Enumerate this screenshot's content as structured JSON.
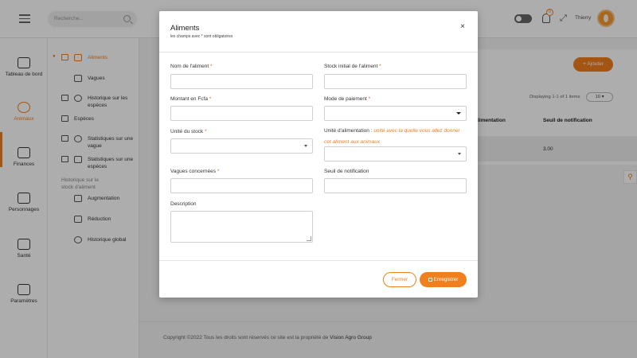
{
  "topbar": {
    "search_placeholder": "Recherche...",
    "notification_count": "0",
    "username": "Thierry"
  },
  "leftnav": {
    "items": [
      {
        "label": "Tableau de bord",
        "icon": "gauge-icon"
      },
      {
        "label": "Animaux",
        "icon": "paw-icon",
        "active": true
      },
      {
        "label": "Finances",
        "icon": "coins-icon"
      },
      {
        "label": "Personnages",
        "icon": "people-icon"
      },
      {
        "label": "Santé",
        "icon": "ambulance-icon"
      },
      {
        "label": "Paramètres",
        "icon": "sliders-icon"
      }
    ]
  },
  "subnav": {
    "items": [
      {
        "label": "Aliments",
        "active": true
      },
      {
        "label": "Vagues"
      },
      {
        "label": "Historique sur les espèces"
      },
      {
        "label": "Espèces"
      },
      {
        "label": "Statistiques sur une vague"
      },
      {
        "label": "Statistiques sur une espèces"
      },
      {
        "label": "Historique sur le stock d'aliment"
      },
      {
        "label": "Augmentation"
      },
      {
        "label": "Réduction"
      },
      {
        "label": "Historique global"
      }
    ]
  },
  "main": {
    "add_button": "+ Ajouter",
    "displaying": "Displaying 1-1 of 1 items",
    "page_size": "10 ▾",
    "table_headers": [
      "d'alimentation",
      "Seuil de notification"
    ],
    "row_values": [
      "3.00"
    ],
    "footer_text": "Copyright ©2022 Tous les droits sont réservés ce site est la propriété de ",
    "footer_brand": "Vision Agro Group"
  },
  "modal": {
    "title": "Aliments",
    "subtitle": "les champs avec * sont obligatoires",
    "close_symbol": "×",
    "fields": {
      "nom": {
        "label": "Nom de l'aliment",
        "required": "*",
        "value": ""
      },
      "stock_initial": {
        "label": "Stock initial de l'aliment",
        "required": "*",
        "value": ""
      },
      "montant": {
        "label": "Montant en Fcfa",
        "required": "*",
        "value": ""
      },
      "mode_paiement": {
        "label": "Mode de paiement",
        "required": "*",
        "value": ""
      },
      "unite_stock": {
        "label": "Unité du stock",
        "required": "*",
        "value": ""
      },
      "unite_alimentation": {
        "label": "Unité d'alimentation :",
        "hint_line1": "unité avec la quelle vous allez donner",
        "hint_line2": "cet aliment aux animaux",
        "value": ""
      },
      "vagues": {
        "label": "Vagues concernées",
        "required": "*",
        "value": ""
      },
      "seuil": {
        "label": "Seuil de notification",
        "value": ""
      },
      "description": {
        "label": "Description",
        "value": ""
      }
    },
    "buttons": {
      "close": "Fermer",
      "save": "Enregistrer"
    }
  },
  "colors": {
    "accent": "#f07f1d",
    "required": "#e8612b"
  }
}
